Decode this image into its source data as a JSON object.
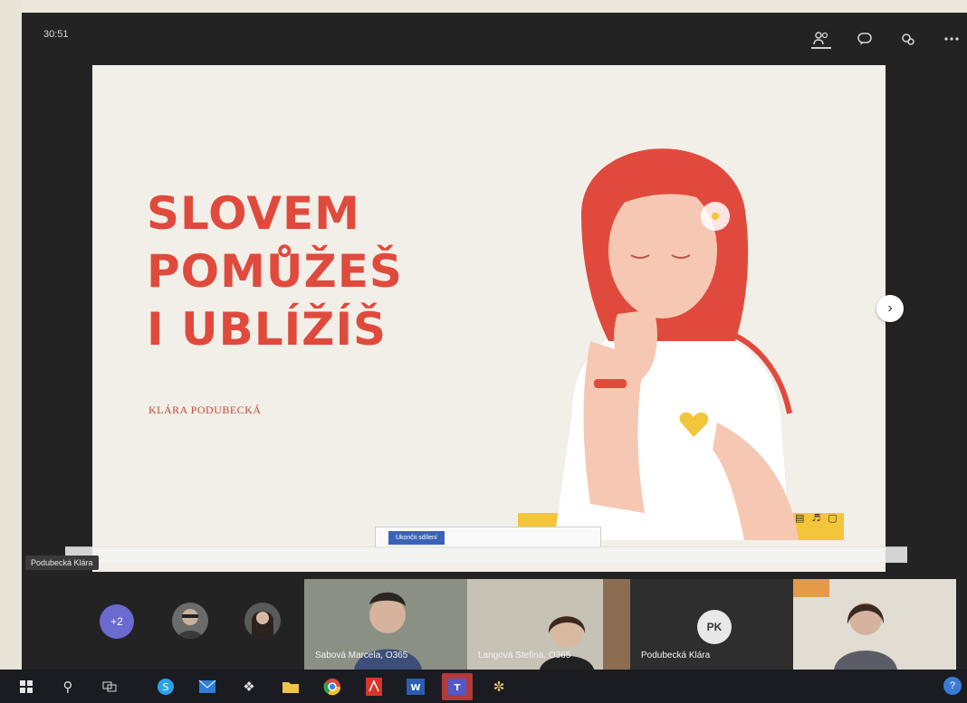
{
  "call": {
    "timer": "30:51",
    "header_icons": [
      "participants-icon",
      "chat-icon",
      "reactions-icon",
      "more-icon"
    ]
  },
  "slide": {
    "title_lines": [
      "SLOVEM",
      "POMŮŽEŠ",
      "I UBLÍŽÍŠ"
    ],
    "author": "KLÁRA PODUBECKÁ",
    "title_color": "#e04a3c",
    "next_icon": "chevron-right-icon"
  },
  "presenter": {
    "name": "Podubecká Klára"
  },
  "share_bar": {
    "button_label": "Ukončit sdílení"
  },
  "participants": {
    "more_count": "+2",
    "tiles": [
      {
        "name": "Sabová Marcela, O365"
      },
      {
        "name": "Langová Stefina, O365"
      },
      {
        "name": "Podubecká Klára",
        "initials": "PK"
      },
      {
        "name": ""
      }
    ]
  },
  "taskbar": {
    "items": [
      "windows-icon",
      "search-icon",
      "task-view-icon",
      "skype-icon",
      "mail-icon",
      "dropbox-icon",
      "file-explorer-icon",
      "chrome-icon",
      "acrobat-icon",
      "word-icon",
      "teams-icon",
      "paint-icon"
    ],
    "help": "?"
  },
  "colors": {
    "accent_teams": "#6a6ad0",
    "slide_red": "#e04a3c",
    "taskbar_bg": "#1b1b22"
  }
}
